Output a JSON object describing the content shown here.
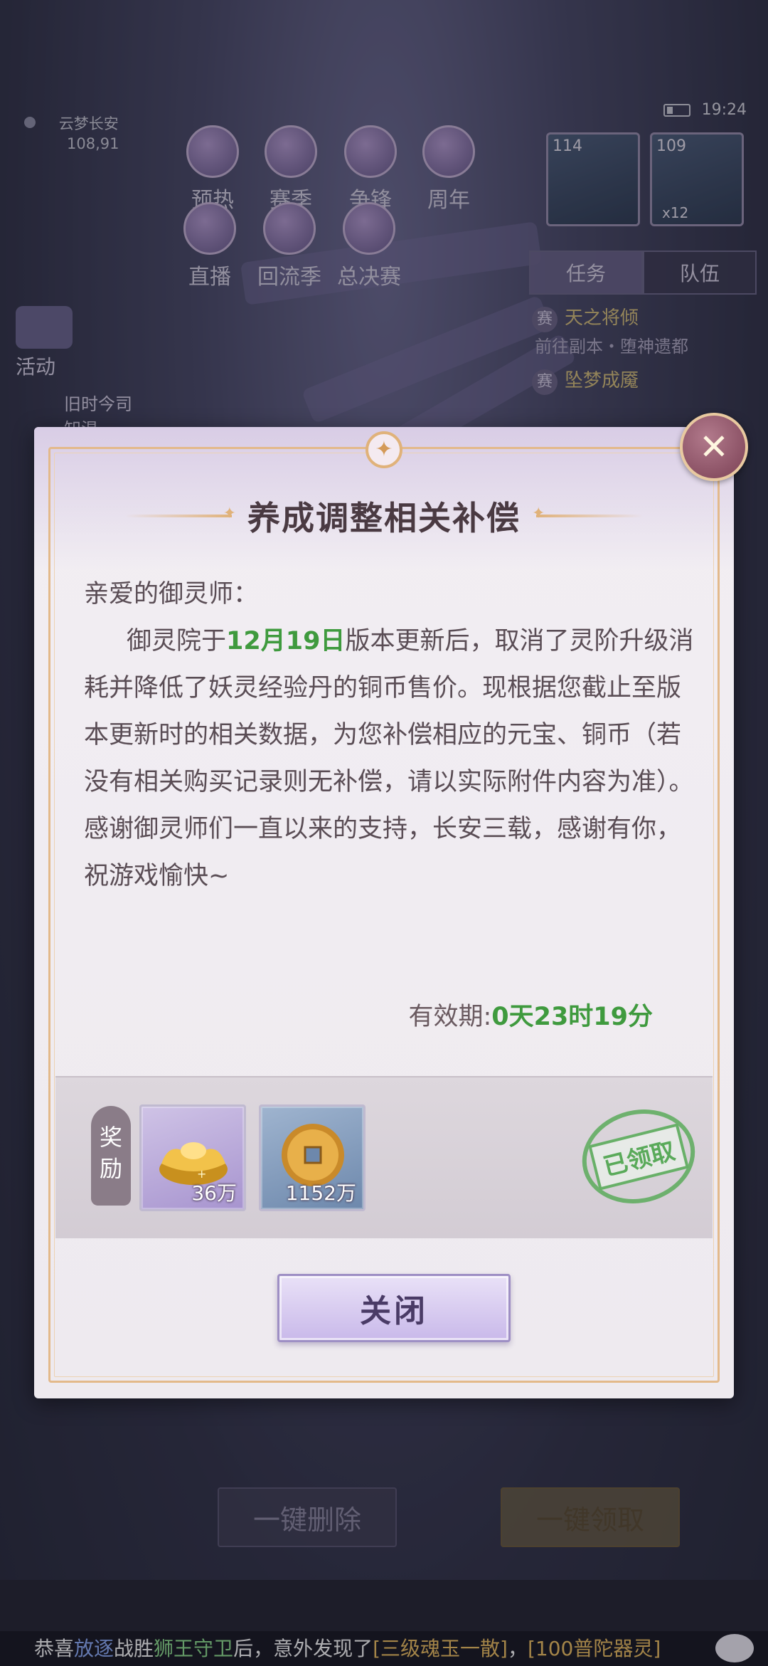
{
  "background": {
    "location_name": "云梦长安",
    "location_coords": "108,91",
    "status_time": "19:24",
    "event_icons": [
      "预热",
      "赛季",
      "争锋",
      "周年",
      "直播",
      "回流季",
      "总决赛"
    ],
    "avatar_levels": [
      "114",
      "109"
    ],
    "avatar_badge": "x12",
    "panel_tabs": [
      "任务",
      "队伍"
    ],
    "tasks": [
      {
        "tag": "赛",
        "title": "天之将倾",
        "sub": "前往副本・堕神遗都"
      },
      {
        "tag": "赛",
        "title": "坠梦成魇"
      }
    ],
    "left_buttons": [
      "活动",
      "旧时今司",
      "知温"
    ],
    "bottom_buttons": {
      "delete": "一键删除",
      "collect": "一键领取"
    },
    "ticker": {
      "p1": "恭喜",
      "player": "放逐",
      "p2": "战胜",
      "boss": "狮王守卫",
      "p3": "后，意外发现了",
      "item1": "[三级魂玉一散]",
      "p4": "，",
      "item2": "[100普陀器灵]"
    }
  },
  "dialog": {
    "title": "养成调整相关补偿",
    "greeting": "亲爱的御灵师：",
    "body_before": "御灵院于",
    "body_date": "12月19日",
    "body_after": "版本更新后，取消了灵阶升级消耗并降低了妖灵经验丹的铜币售价。现根据您截止至版本更新时的相关数据，为您补偿相应的元宝、铜币（若没有相关购买记录则无补偿，请以实际附件内容为准）。感谢御灵师们一直以来的支持，长安三载，感谢有你，祝游戏愉快~",
    "validity_label": "有效期:",
    "validity_time": "0天23时19分",
    "reward_label": "奖励",
    "rewards": [
      {
        "name": "元宝",
        "icon": "gold-ingot-icon",
        "amount": "36万"
      },
      {
        "name": "铜币",
        "icon": "copper-coin-icon",
        "amount": "1152万"
      }
    ],
    "claimed_stamp": "已领取",
    "close_button": "关闭"
  },
  "colors": {
    "highlight_green": "#3f9a3e",
    "frame_gold": "#e3b98a",
    "button_purple": "#c9b9ea"
  }
}
